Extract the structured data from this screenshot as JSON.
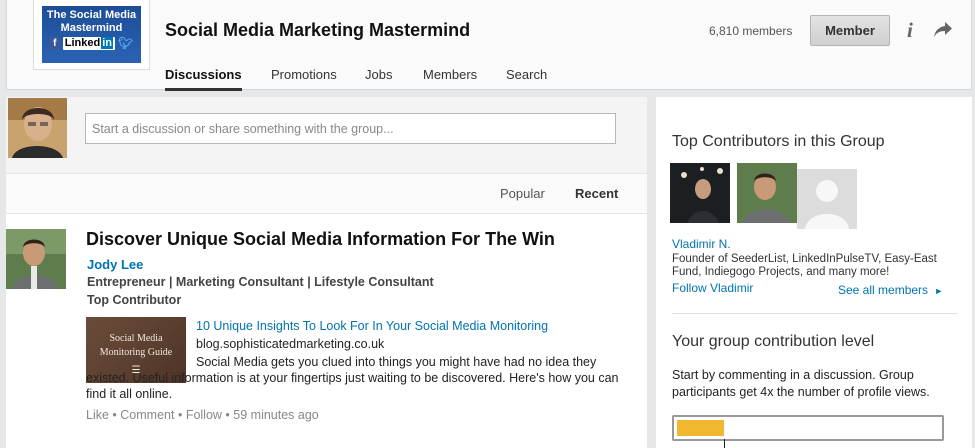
{
  "group": {
    "logo_line1": "The Social Media",
    "logo_line2": "Mastermind",
    "logo_linkedin": "Linked",
    "logo_linkedin_in": "in",
    "name": "Social Media Marketing Mastermind",
    "member_count": "6,810 members",
    "member_button": "Member"
  },
  "tabs": [
    {
      "label": "Discussions",
      "active": true
    },
    {
      "label": "Promotions"
    },
    {
      "label": "Jobs"
    },
    {
      "label": "Members"
    },
    {
      "label": "Search"
    }
  ],
  "composer": {
    "placeholder": "Start a discussion or share something with the group..."
  },
  "sort": {
    "popular": "Popular",
    "recent": "Recent"
  },
  "post": {
    "title": "Discover Unique Social Media Information For The Win",
    "author": "Jody Lee",
    "headline": "Entrepreneur | Marketing Consultant | Lifestyle Consultant",
    "badge": "Top Contributor",
    "thumb_line1": "Social Media",
    "thumb_line2": "Monitoring Guide",
    "link_title": "10 Unique Insights To Look For In Your Social Media Monitoring",
    "link_domain": "blog.sophisticatedmarketing.co.uk",
    "description": "Social Media gets you clued into things you might have had no idea they existed. Useful information is at your fingertips just waiting to be discovered. Here's how you can find it all online.",
    "actions": {
      "like": "Like",
      "comment": "Comment",
      "follow": "Follow",
      "time": "59 minutes ago"
    }
  },
  "sidebar": {
    "top_contributors_heading": "Top Contributors in this Group",
    "contributor_name": "Vladimir N.",
    "contributor_desc": "Founder of SeederList, LinkedInPulseTV, Easy-East Fund, Indiegogo Projects, and many more!",
    "follow_label": "Follow Vladimir",
    "see_all": "See all members",
    "contribution_heading": "Your group contribution level",
    "contribution_text": "Start by commenting in a discussion. Group participants get 4x the number of profile views.",
    "contribution_progress": 0.18
  },
  "colors": {
    "link": "#0073b1",
    "progress": "#f1b72e"
  }
}
